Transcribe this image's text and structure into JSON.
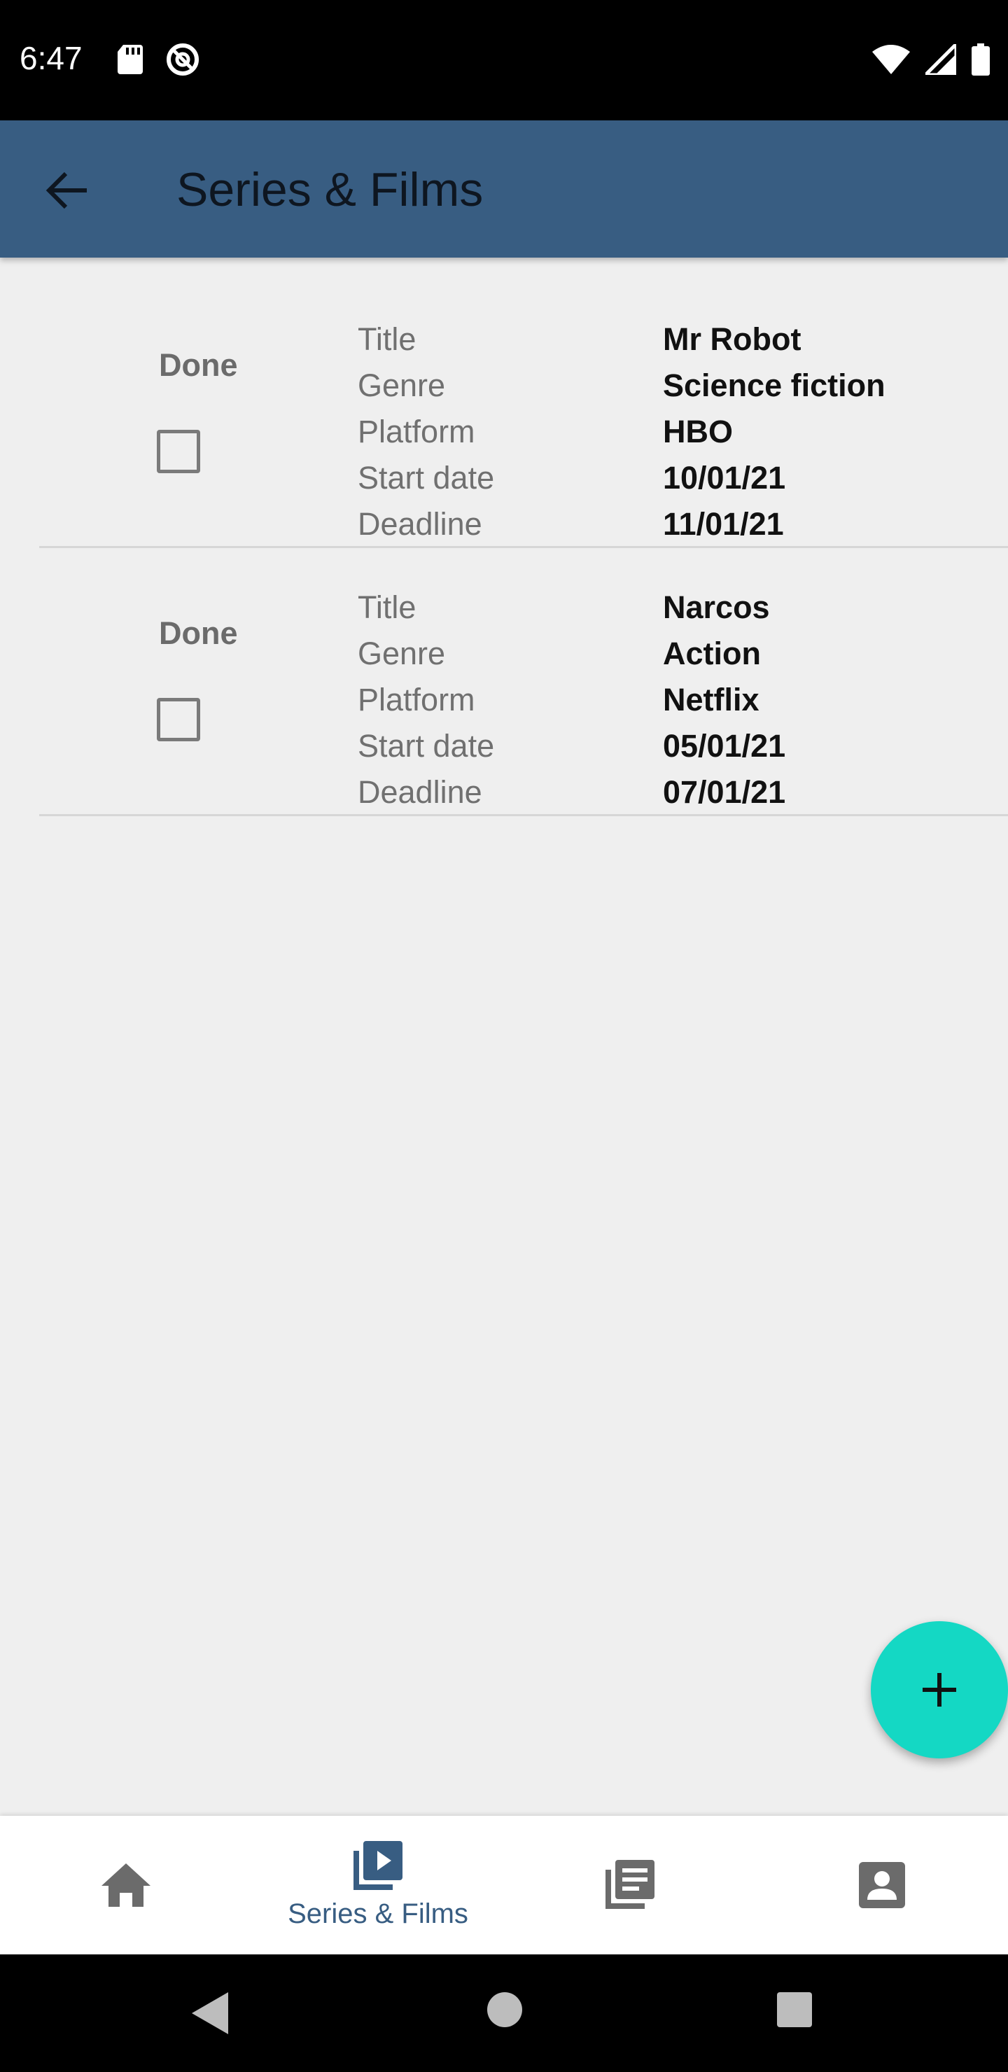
{
  "status_bar": {
    "time": "6:47"
  },
  "app_bar": {
    "title": "Series & Films"
  },
  "items": [
    {
      "done_label": "Done",
      "fields": [
        {
          "label": "Title",
          "value": "Mr Robot"
        },
        {
          "label": "Genre",
          "value": "Science fiction"
        },
        {
          "label": "Platform",
          "value": "HBO"
        },
        {
          "label": "Start date",
          "value": "10/01/21"
        },
        {
          "label": "Deadline",
          "value": "11/01/21"
        }
      ]
    },
    {
      "done_label": "Done",
      "fields": [
        {
          "label": "Title",
          "value": "Narcos"
        },
        {
          "label": "Genre",
          "value": "Action"
        },
        {
          "label": "Platform",
          "value": "Netflix"
        },
        {
          "label": "Start date",
          "value": "05/01/21"
        },
        {
          "label": "Deadline",
          "value": "07/01/21"
        }
      ]
    }
  ],
  "bottom_nav": {
    "items": [
      {
        "icon": "home-icon",
        "label": ""
      },
      {
        "icon": "video-library-icon",
        "label": "Series & Films"
      },
      {
        "icon": "notes-icon",
        "label": ""
      },
      {
        "icon": "account-box-icon",
        "label": ""
      }
    ],
    "active_index": 1
  },
  "colors": {
    "app_bar": "#385d82",
    "fab": "#14d8c4",
    "active_nav": "#385d82"
  }
}
